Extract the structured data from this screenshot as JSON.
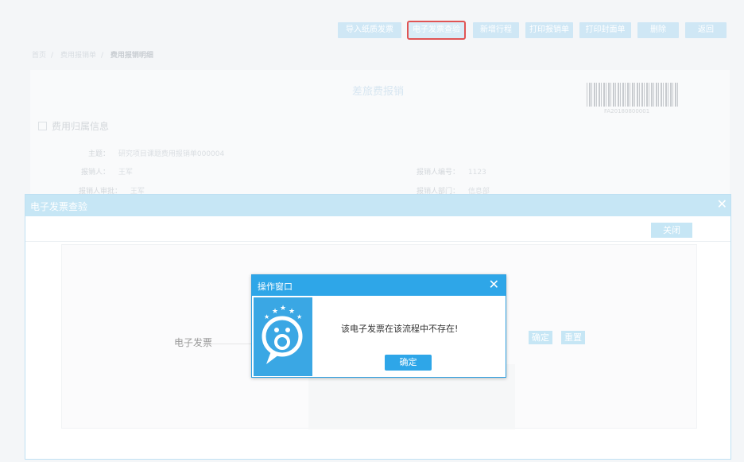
{
  "toolbar": {
    "buttons": [
      {
        "label": "导入纸质发票"
      },
      {
        "label": "电子发票查验"
      },
      {
        "label": "新增行程"
      },
      {
        "label": "打印报销单"
      },
      {
        "label": "打印封面单"
      },
      {
        "label": "删除"
      },
      {
        "label": "返回"
      }
    ]
  },
  "breadcrumb": {
    "items": [
      "首页",
      "费用报销单",
      "费用报销明细"
    ]
  },
  "form": {
    "title": "差旅费报销",
    "barcode_number": "FA20180800001",
    "section_title": "费用归属信息",
    "fields": {
      "subject_label": "主题：",
      "subject_value": "研究项目课题费用报销单000004",
      "applicant_label": "报销人：",
      "applicant_value": "王军",
      "applicant_no_label": "报销人编号：",
      "applicant_no_value": "1123",
      "manager_label": "报销人审批：",
      "manager_value": "王军",
      "dept_label": "报销人部门：",
      "dept_value": "信息部"
    }
  },
  "invoice_dialog": {
    "title": "电子发票查验",
    "close_label": "关闭",
    "invoice_label": "电子发票",
    "confirm_label": "确定",
    "reset_label": "重置"
  },
  "op_popup": {
    "title": "操作窗口",
    "message": "该电子发票在该流程中不存在!",
    "ok_label": "确定"
  },
  "colors": {
    "accent": "#2ea6e8",
    "highlight_border": "#e05454",
    "faded_accent": "#c6e6f5"
  }
}
